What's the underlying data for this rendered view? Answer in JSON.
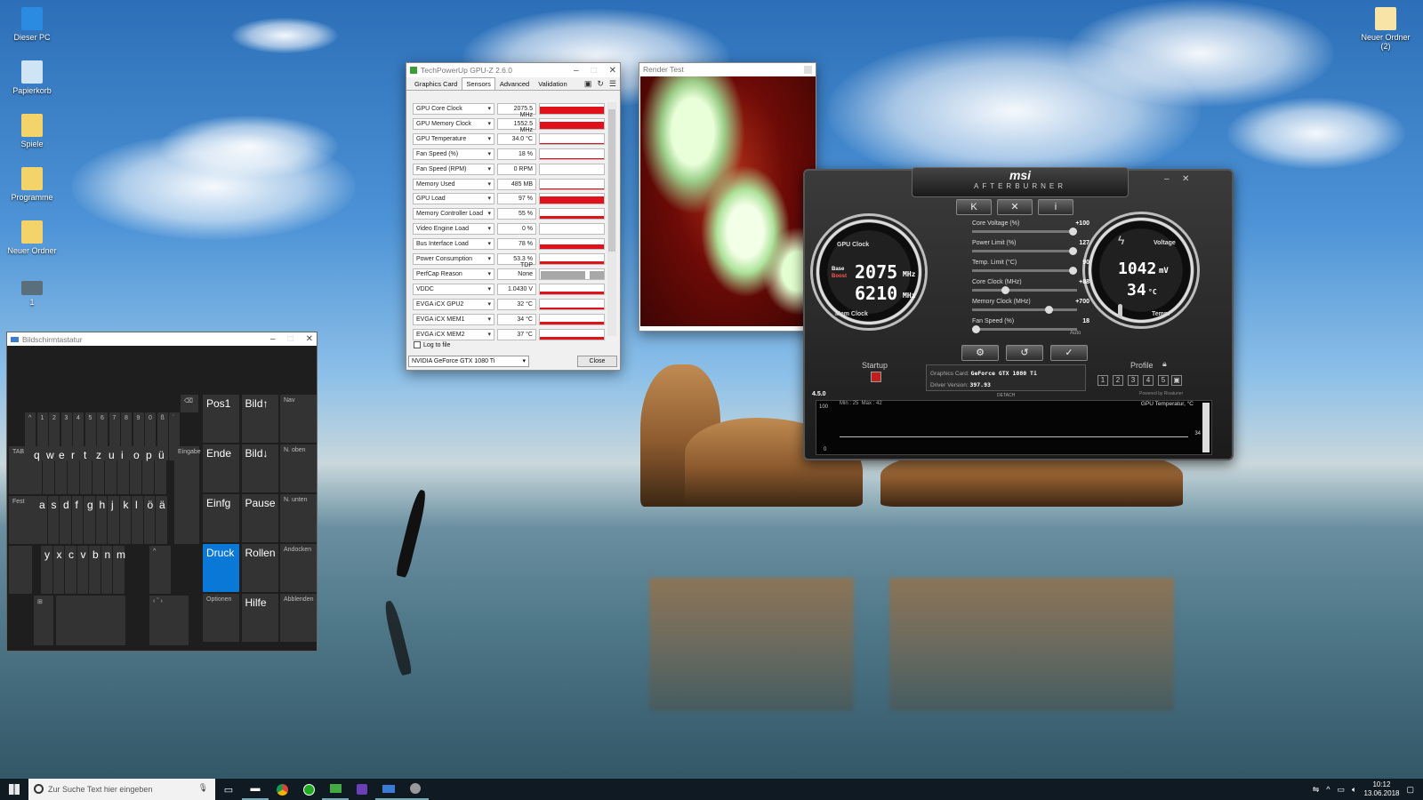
{
  "desktop": {
    "icons": [
      {
        "label": "Dieser PC"
      },
      {
        "label": "Papierkorb"
      },
      {
        "label": "Spiele"
      },
      {
        "label": "Programme"
      },
      {
        "label": "Neuer Ordner"
      },
      {
        "label": "1"
      }
    ],
    "right_icon": {
      "label": "Neuer Ordner (2)"
    }
  },
  "gpuz": {
    "title": "TechPowerUp GPU-Z 2.6.0",
    "tabs": [
      "Graphics Card",
      "Sensors",
      "Advanced",
      "Validation"
    ],
    "active_tab": "Sensors",
    "sensors": [
      {
        "name": "GPU Core Clock",
        "value": "2075.5 MHz",
        "level": 0.95
      },
      {
        "name": "GPU Memory Clock",
        "value": "1552.5 MHz",
        "level": 0.95
      },
      {
        "name": "GPU Temperature",
        "value": "34.0 °C",
        "level": 0.12
      },
      {
        "name": "Fan Speed (%)",
        "value": "18 %",
        "level": 0.08
      },
      {
        "name": "Fan Speed (RPM)",
        "value": "0 RPM",
        "level": 0.0
      },
      {
        "name": "Memory Used",
        "value": "485 MB",
        "level": 0.05
      },
      {
        "name": "GPU Load",
        "value": "97 %",
        "level": 0.97
      },
      {
        "name": "Memory Controller Load",
        "value": "55 %",
        "level": 0.55
      },
      {
        "name": "Video Engine Load",
        "value": "0 %",
        "level": 0.0
      },
      {
        "name": "Bus Interface Load",
        "value": "78 %",
        "level": 0.78
      },
      {
        "name": "Power Consumption",
        "value": "53.3 % TDP",
        "level": 0.53
      },
      {
        "name": "PerfCap Reason",
        "value": "None",
        "level": 0.0
      },
      {
        "name": "VDDC",
        "value": "1.0430 V",
        "level": 0.55
      },
      {
        "name": "EVGA iCX GPU2",
        "value": "32 °C",
        "level": 0.35
      },
      {
        "name": "EVGA iCX MEM1",
        "value": "34 °C",
        "level": 0.38
      },
      {
        "name": "EVGA iCX MEM2",
        "value": "37 °C",
        "level": 0.42
      }
    ],
    "log_label": "Log to file",
    "gpu_select": "NVIDIA GeForce GTX 1080 Ti",
    "close_label": "Close"
  },
  "render_test": {
    "title": "Render Test"
  },
  "afterburner": {
    "brand": "msi",
    "product": "AFTERBURNER",
    "gpu_clock_label": "GPU Clock",
    "mem_clock_label": "Mem Clock",
    "base_label": "Base",
    "boost_label": "Boost",
    "core_clock_value": "2075",
    "core_clock_unit": "MHz",
    "mem_clock_value": "6210",
    "mem_clock_unit": "MHz",
    "voltage_label": "Voltage",
    "temp_label": "Temp.",
    "voltage_value": "1042",
    "voltage_unit": "mV",
    "temp_value": "34",
    "temp_unit": "°C",
    "sliders": [
      {
        "label": "Core Voltage (%)",
        "value": "+100",
        "level": 1.0
      },
      {
        "label": "Power Limit (%)",
        "value": "127",
        "level": 1.0
      },
      {
        "label": "Temp. Limit (°C)",
        "value": "90",
        "level": 1.0
      },
      {
        "label": "Core Clock (MHz)",
        "value": "+88",
        "level": 0.3
      },
      {
        "label": "Memory Clock (MHz)",
        "value": "+700",
        "level": 0.75
      },
      {
        "label": "Fan Speed (%)",
        "value": "18",
        "level": 0.0
      }
    ],
    "fan_auto": "Auto",
    "startup_label": "Startup",
    "profile_label": "Profile",
    "profiles": [
      "1",
      "2",
      "3",
      "4",
      "5"
    ],
    "graphics_card_label": "Graphics Card:",
    "graphics_card_value": "GeForce GTX 1080 Ti",
    "driver_label": "Driver Version:",
    "driver_value": "397.93",
    "detach_label": "DETACH",
    "version": "4.5.0",
    "graph_minmax": "Min : 25  Max : 42",
    "graph_max": "100",
    "graph_min": "0",
    "graph_title": "GPU Temperatur, °C",
    "graph_current": "34",
    "powered_by": "Powered by Rivatuner"
  },
  "keyboard": {
    "title": "Bildschirmtastatur",
    "row_num": [
      "^",
      "1",
      "2",
      "3",
      "4",
      "5",
      "6",
      "7",
      "8",
      "9",
      "0",
      "ß",
      "´"
    ],
    "row_q": [
      "q",
      "w",
      "e",
      "r",
      "t",
      "z",
      "u",
      "i",
      "o",
      "p",
      "ü"
    ],
    "row_a": [
      "a",
      "s",
      "d",
      "f",
      "g",
      "h",
      "j",
      "k",
      "l",
      "ö",
      "ä"
    ],
    "row_y": [
      "y",
      "x",
      "c",
      "v",
      "b",
      "n",
      "m"
    ],
    "tab_label": "TAB",
    "fest_label": "Fest",
    "enter_label": "Eingabe",
    "nav_keys": [
      [
        "Pos1",
        "Bild↑",
        "Nav"
      ],
      [
        "Ende",
        "Bild↓",
        "N. oben"
      ],
      [
        "Einfg",
        "Pause",
        "N. unten"
      ],
      [
        "Druck",
        "Rollen",
        "Andocken"
      ],
      [
        "Optionen",
        "Hilfe",
        "Abblenden"
      ]
    ]
  },
  "taskbar": {
    "search_placeholder": "Zur Suche Text hier eingeben",
    "time": "10:12",
    "date": "13.06.2018"
  },
  "colors": {
    "accent": "#0a78d7",
    "sensor_bar": "#e0111a"
  }
}
